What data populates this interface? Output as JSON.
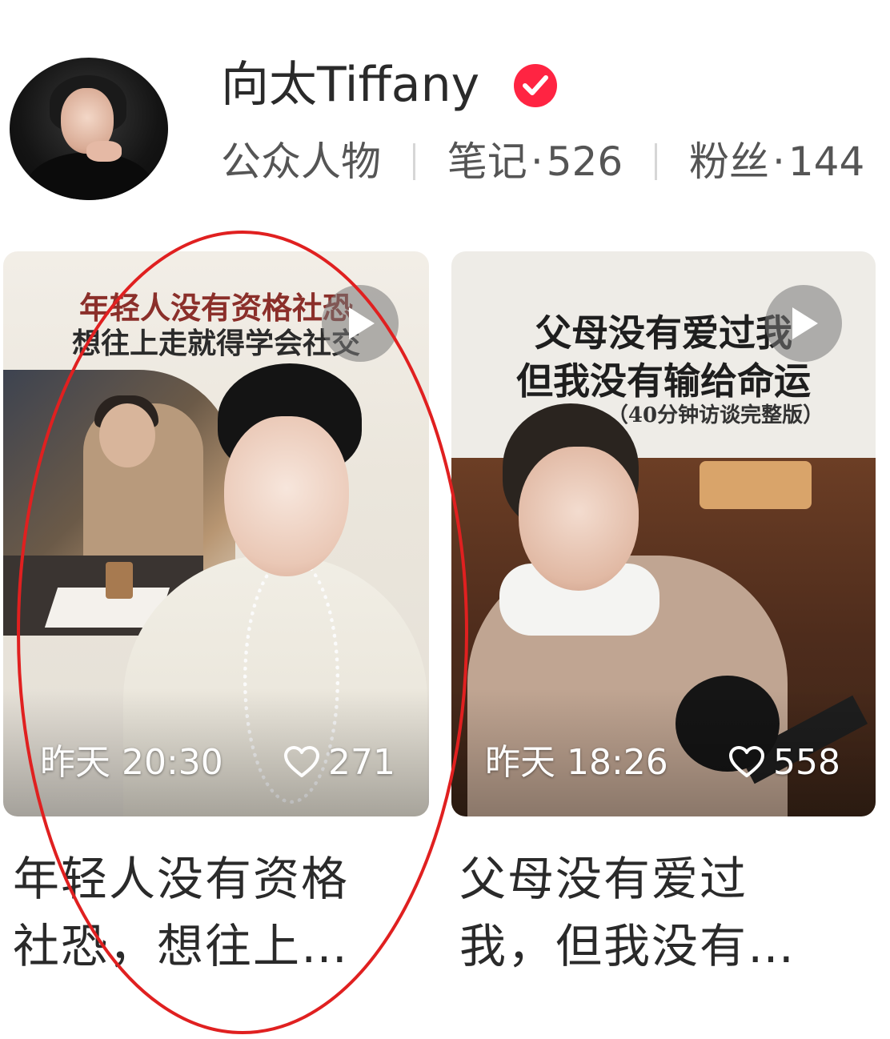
{
  "profile": {
    "name": "向太Tiffany",
    "category": "公众人物",
    "notes_label": "笔记",
    "notes_count": "526",
    "fans_label": "粉丝",
    "fans_count": "144",
    "stat_dot": "·",
    "verified_color": "#ff2442"
  },
  "cards": [
    {
      "overlay_line1": "年轻人没有资格社恐",
      "overlay_line2": "想往上走就得学会社交",
      "time": "昨天 20:30",
      "likes": "271",
      "title_line1": "年轻人没有资格",
      "title_line2": "社恐，想往上…",
      "type_icon": "play-icon"
    },
    {
      "overlay_line1": "父母没有爱过我",
      "overlay_line2": "但我没有输给命运",
      "overlay_line3": "（40分钟访谈完整版）",
      "time": "昨天 18:26",
      "likes": "558",
      "title_line1": "父母没有爱过",
      "title_line2": "我，但我没有…",
      "type_icon": "play-icon"
    }
  ],
  "annotation_color": "#e02020"
}
